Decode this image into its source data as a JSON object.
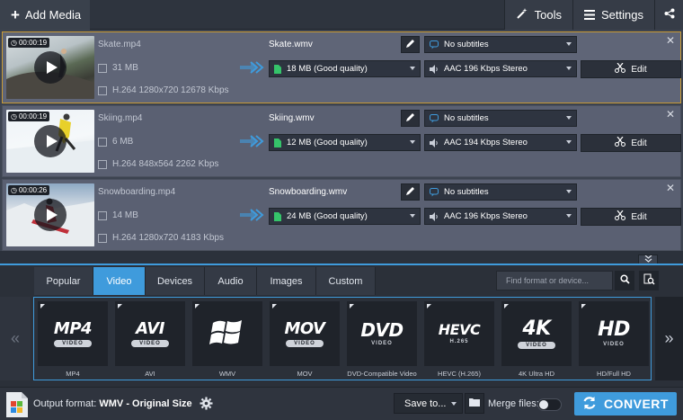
{
  "topbar": {
    "add_media": "Add Media",
    "tools": "Tools",
    "settings": "Settings"
  },
  "files": [
    {
      "duration": "00:00:19",
      "source_name": "Skate.mp4",
      "source_size": "31 MB",
      "source_info": "H.264 1280x720 12678 Kbps",
      "output_name": "Skate.wmv",
      "output_size": "18 MB (Good quality)",
      "subtitles": "No subtitles",
      "audio": "AAC 196 Kbps Stereo",
      "edit": "Edit",
      "selected": true
    },
    {
      "duration": "00:00:19",
      "source_name": "Skiing.mp4",
      "source_size": "6 MB",
      "source_info": "H.264 848x564 2262 Kbps",
      "output_name": "Skiing.wmv",
      "output_size": "12 MB (Good quality)",
      "subtitles": "No subtitles",
      "audio": "AAC 194 Kbps Stereo",
      "edit": "Edit",
      "selected": false
    },
    {
      "duration": "00:00:26",
      "source_name": "Snowboarding.mp4",
      "source_size": "14 MB",
      "source_info": "H.264 1280x720 4183 Kbps",
      "output_name": "Snowboarding.wmv",
      "output_size": "24 MB (Good quality)",
      "subtitles": "No subtitles",
      "audio": "AAC 196 Kbps Stereo",
      "edit": "Edit",
      "selected": false
    }
  ],
  "tabs": [
    {
      "label": "Popular",
      "active": false
    },
    {
      "label": "Video",
      "active": true
    },
    {
      "label": "Devices",
      "active": false
    },
    {
      "label": "Audio",
      "active": false
    },
    {
      "label": "Images",
      "active": false
    },
    {
      "label": "Custom",
      "active": false
    }
  ],
  "search": {
    "placeholder": "Find format or device..."
  },
  "formats": [
    {
      "logo": "MP4",
      "badge": "VIDEO",
      "label": "MP4"
    },
    {
      "logo": "AVI",
      "badge": "VIDEO",
      "label": "AVI"
    },
    {
      "logo": "",
      "badge": "",
      "label": "WMV"
    },
    {
      "logo": "MOV",
      "badge": "VIDEO",
      "label": "MOV"
    },
    {
      "logo": "DVD",
      "badge": "VIDEO",
      "label": "DVD-Compatible Video"
    },
    {
      "logo": "HEVC",
      "badge": "H.265",
      "label": "HEVC (H.265)"
    },
    {
      "logo": "4K",
      "badge": "VIDEO",
      "label": "4K Ultra HD"
    },
    {
      "logo": "HD",
      "badge": "VIDEO",
      "label": "HD/Full HD"
    }
  ],
  "nav": {
    "prev": "«",
    "next": "»"
  },
  "bottom": {
    "output_label": "Output format:",
    "output_format": "WMV - Original Size",
    "save_to": "Save to...",
    "merge_files": "Merge files:",
    "convert": "CONVERT"
  },
  "colors": {
    "accent": "#3f9bdc",
    "selected_border": "#c89a35",
    "arrow": "#3f9bdc",
    "file_icon": "#35c46a"
  }
}
